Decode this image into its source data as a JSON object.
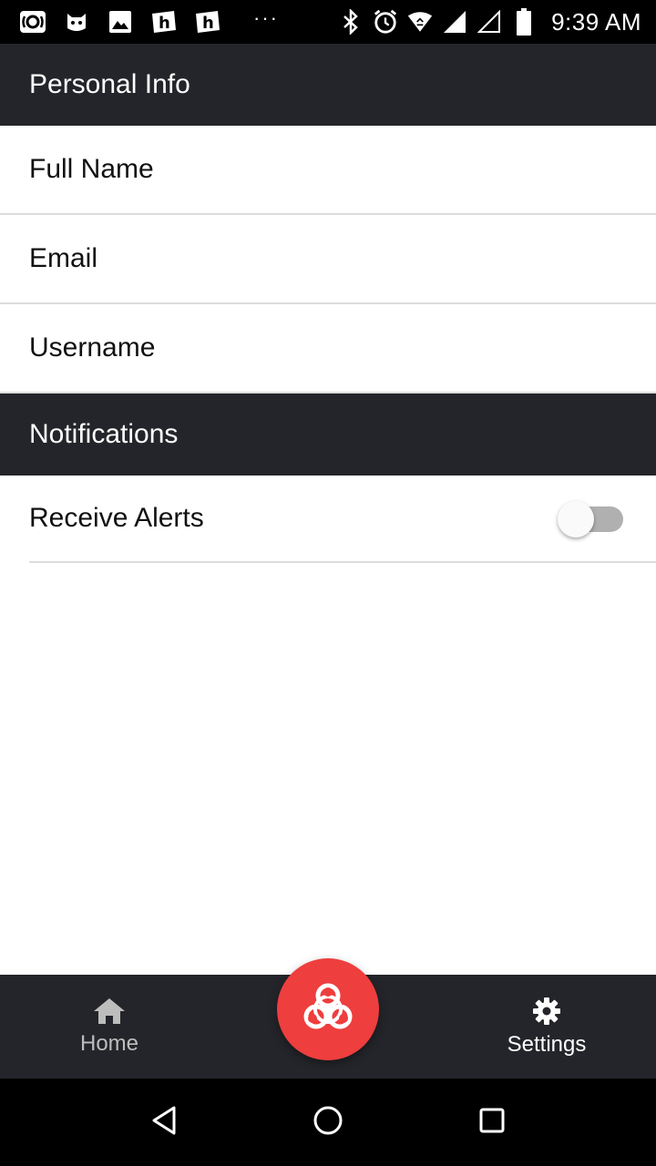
{
  "status_bar": {
    "time": "9:39 AM",
    "dots": "···",
    "left_icons": [
      "radio-icon",
      "cat-icon",
      "image-icon",
      "h-app-icon",
      "h-app-icon"
    ],
    "right_icons": [
      "bluetooth-icon",
      "alarm-icon",
      "wifi-icon",
      "signal-icon",
      "signal-empty-icon",
      "battery-icon"
    ]
  },
  "sections": {
    "personal_info": {
      "title": "Personal Info",
      "items": [
        "Full Name",
        "Email",
        "Username"
      ]
    },
    "notifications": {
      "title": "Notifications",
      "receive_alerts_label": "Receive Alerts",
      "receive_alerts_on": false
    }
  },
  "tab_bar": {
    "home_label": "Home",
    "settings_label": "Settings",
    "active_tab": "settings",
    "fab_icon": "biohazard-icon"
  },
  "colors": {
    "header_bg": "#24252a",
    "fab_bg": "#ee3e3e",
    "divider": "#dcdcdc"
  }
}
